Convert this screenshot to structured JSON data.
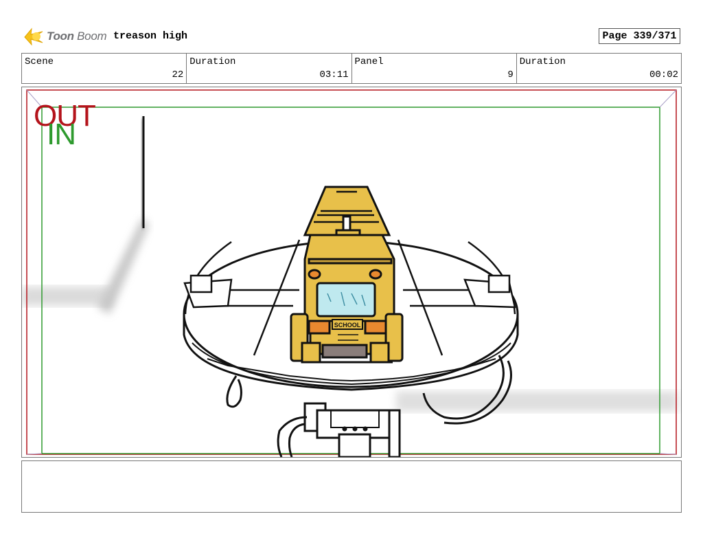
{
  "header": {
    "logo_text_bold": "Toon",
    "logo_text_rest": " Boom",
    "project_title": "treason high",
    "page_label": "Page 339/371"
  },
  "info": {
    "scene_label": "Scene",
    "scene_value": "22",
    "scene_duration_label": "Duration",
    "scene_duration_value": "03:11",
    "panel_label": "Panel",
    "panel_value": "9",
    "panel_duration_label": "Duration",
    "panel_duration_value": "00:02"
  },
  "panel": {
    "frame_out_label": "OUT",
    "frame_in_label": "IN",
    "bus_sign": "SCHOOL",
    "colors": {
      "out_frame": "#b4131b",
      "in_frame": "#2e9a2e",
      "bus_yellow": "#e8c04a",
      "windshield": "#bfe9ef"
    }
  },
  "notes": {
    "text": ""
  }
}
